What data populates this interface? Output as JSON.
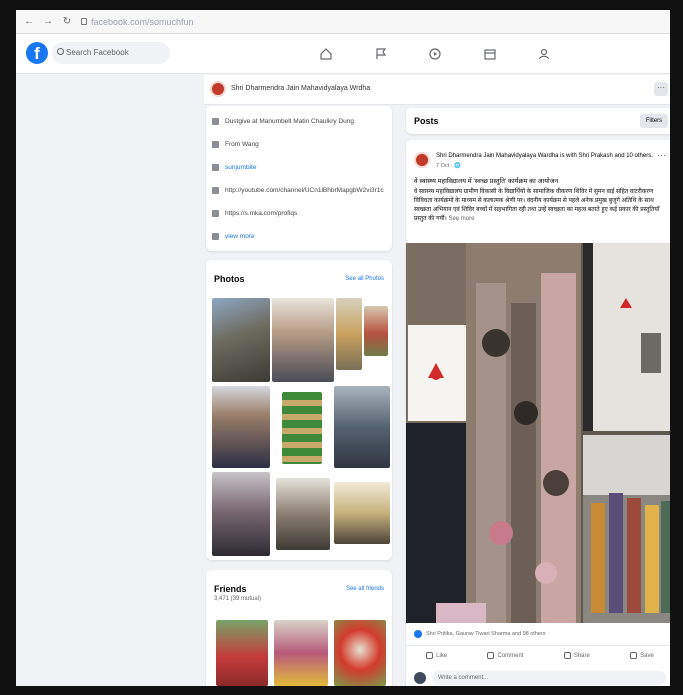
{
  "browser": {
    "back": "←",
    "forward": "→",
    "reload": "↻",
    "url": "facebook.com/somuchfun"
  },
  "header": {
    "logo": "f",
    "search_placeholder": "Search Facebook",
    "nav_icons": [
      "home-icon",
      "flag-icon",
      "play-icon",
      "marketplace-icon",
      "groups-icon"
    ]
  },
  "profile_strip": {
    "name": "Shri Dharmendra Jain Mahavidyalaya Wrdha",
    "more": "···"
  },
  "intro": {
    "items": [
      {
        "icon": "briefcase-icon",
        "text": "Dustgive at Manumbelt Matin Chaulkry Dung",
        "link": false
      },
      {
        "icon": "home-icon",
        "text": "From Wang",
        "link": false
      },
      {
        "icon": "link-icon",
        "text": "sunjumbite",
        "link": true
      },
      {
        "icon": "globe-icon",
        "text": "http://youtube.com/channel/UCn1lBhbrMapgbW2vi3r1c",
        "link": false
      },
      {
        "icon": "link-icon",
        "text": "https://s.mka.com/profiqs",
        "link": false
      },
      {
        "icon": "star-icon",
        "text": "view more",
        "link": true
      }
    ]
  },
  "photos": {
    "title": "Photos",
    "link": "See all Photos"
  },
  "friends": {
    "title": "Friends",
    "subtitle": "3,471 (39 mutual)",
    "link": "See all friends"
  },
  "posts": {
    "title": "Posts",
    "filters": "Filters"
  },
  "post": {
    "author": "Shri Dharmendra Jain Mahavidyalaya Wardha is with Shri Prakash and 10 others.",
    "time": "7 Oct · 🌐",
    "headline": "वे स्वास्थ्य महाविद्यालय में 'स्वच्छ प्रस्तुति' कार्यक्रम का आयोजन",
    "body": "वे स्वास्थ्य महाविद्यालय ग्रामीण विकासी के विद्यार्थियों के सामाजिक वीकरण शिविर में सुमन वाई सहित वाटरीकरण विविधता कार्यक्रमों के माध्यम से कलात्मक श्रेणी पर। वंदनीय कार्यक्रम से पहले अनेक प्रमुख बुजुर्ग अतिथि के साथ स्वच्छता अभियान एवं शिविर बच्चों में सहभागिता रही तथा उन्हें स्वच्छता का महत्व बताते हुए कई प्रकार की प्रस्तुतियाँ प्रस्तुत की गयीं।",
    "see_more": "See more",
    "reactions": "Shri Pritika, Gaurav Tiwari Sharma and 98 others",
    "actions": [
      "Like",
      "Comment",
      "Share",
      "Save"
    ],
    "comment_placeholder": "Write a comment..."
  },
  "colors": {
    "brand": "#1877f2",
    "background": "#f0f2f5",
    "link": "#1b74e4"
  }
}
